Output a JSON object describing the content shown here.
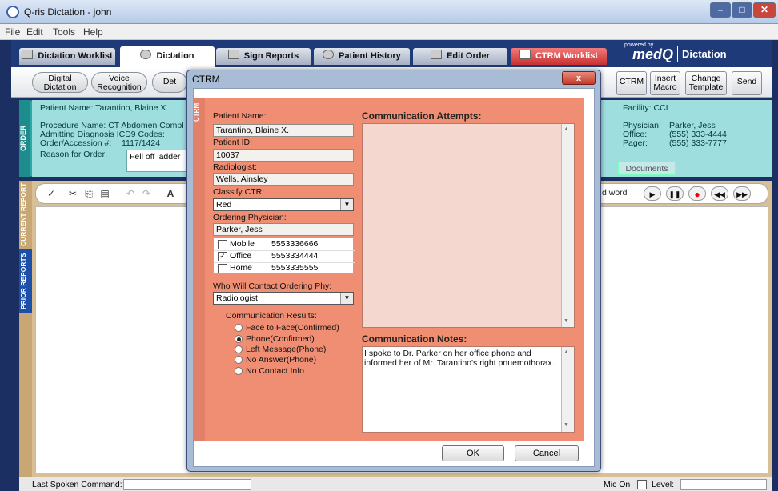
{
  "window": {
    "title": "Q-ris Dictation - john"
  },
  "menu": [
    "File",
    "Edit",
    "Tools",
    "Help"
  ],
  "tabs": [
    {
      "label": "Dictation Worklist"
    },
    {
      "label": "Dictation"
    },
    {
      "label": "Sign Reports"
    },
    {
      "label": "Patient History"
    },
    {
      "label": "Edit Order"
    },
    {
      "label": "CTRM Worklist"
    }
  ],
  "brand": {
    "powered_by": "powered by",
    "logo": "medQ",
    "product": "Dictation"
  },
  "toolbar": {
    "digital_dictation": "Digital Dictation",
    "voice_recognition": "Voice Recognition",
    "det": "Det",
    "ctrm": "CTRM",
    "insert_macro": "Insert Macro",
    "change_template": "Change Template",
    "send": "Send"
  },
  "order": {
    "side_label": "ORDER",
    "patient_name_line": "Patient Name: Tarantino, Blaine X.",
    "procedure_line": "Procedure Name:  CT Abdomen Compl",
    "admitting_line": "Admitting Diagnosis ICD9 Codes:",
    "accession_label": "Order/Accession #:",
    "accession_value": "1117/1424",
    "reason_label": "Reason for Order:",
    "reason_value": "Fell off ladder",
    "facility_line": "Facility: CCI",
    "physician_label": "Physician:",
    "physician_value": "Parker, Jess",
    "office_label": "Office:",
    "office_value": "(555) 333-4444",
    "pager_label": "Pager:",
    "pager_value": "(555) 333-7777",
    "documents_label": "Documents"
  },
  "report": {
    "current_label": "CURRENT REPORT",
    "prior_label": "PRIOR REPORTS",
    "word_label": "d word"
  },
  "status": {
    "last_command_label": "Last Spoken Command:",
    "mic_label": "Mic On",
    "level_label": "Level:"
  },
  "dialog": {
    "title": "CTRM",
    "side_label": "CTRM",
    "close_label": "x",
    "patient_name_label": "Patient Name:",
    "patient_name": "Tarantino, Blaine X.",
    "patient_id_label": "Patient ID:",
    "patient_id": "10037",
    "radiologist_label": "Radiologist:",
    "radiologist": "Wells, Ainsley",
    "classify_label": "Classify CTR:",
    "classify_value": "Red",
    "ordering_label": "Ordering Physician:",
    "ordering_value": "Parker, Jess",
    "phones": [
      {
        "type": "Mobile",
        "number": "5553336666",
        "checked": false
      },
      {
        "type": "Office",
        "number": "5553334444",
        "checked": true
      },
      {
        "type": "Home",
        "number": "5553335555",
        "checked": false
      }
    ],
    "who_label": "Who Will Contact Ordering Phy:",
    "who_value": "Radiologist",
    "results_label": "Communication Results:",
    "results": [
      {
        "label": "Face to Face(Confirmed)",
        "selected": false
      },
      {
        "label": "Phone(Confirmed)",
        "selected": true
      },
      {
        "label": "Left Message(Phone)",
        "selected": false
      },
      {
        "label": "No Answer(Phone)",
        "selected": false
      },
      {
        "label": "No Contact Info",
        "selected": false
      }
    ],
    "attempts_label": "Communication Attempts:",
    "notes_label": "Communication Notes:",
    "notes_text": "I spoke to Dr. Parker on her office phone and informed her of Mr. Tarantino's right pnuemothorax.",
    "ok_label": "OK",
    "cancel_label": "Cancel"
  },
  "colors": {
    "ctrm_panel": "#ef8e73",
    "order_panel": "#9fdede",
    "nav": "#1f3a78"
  }
}
